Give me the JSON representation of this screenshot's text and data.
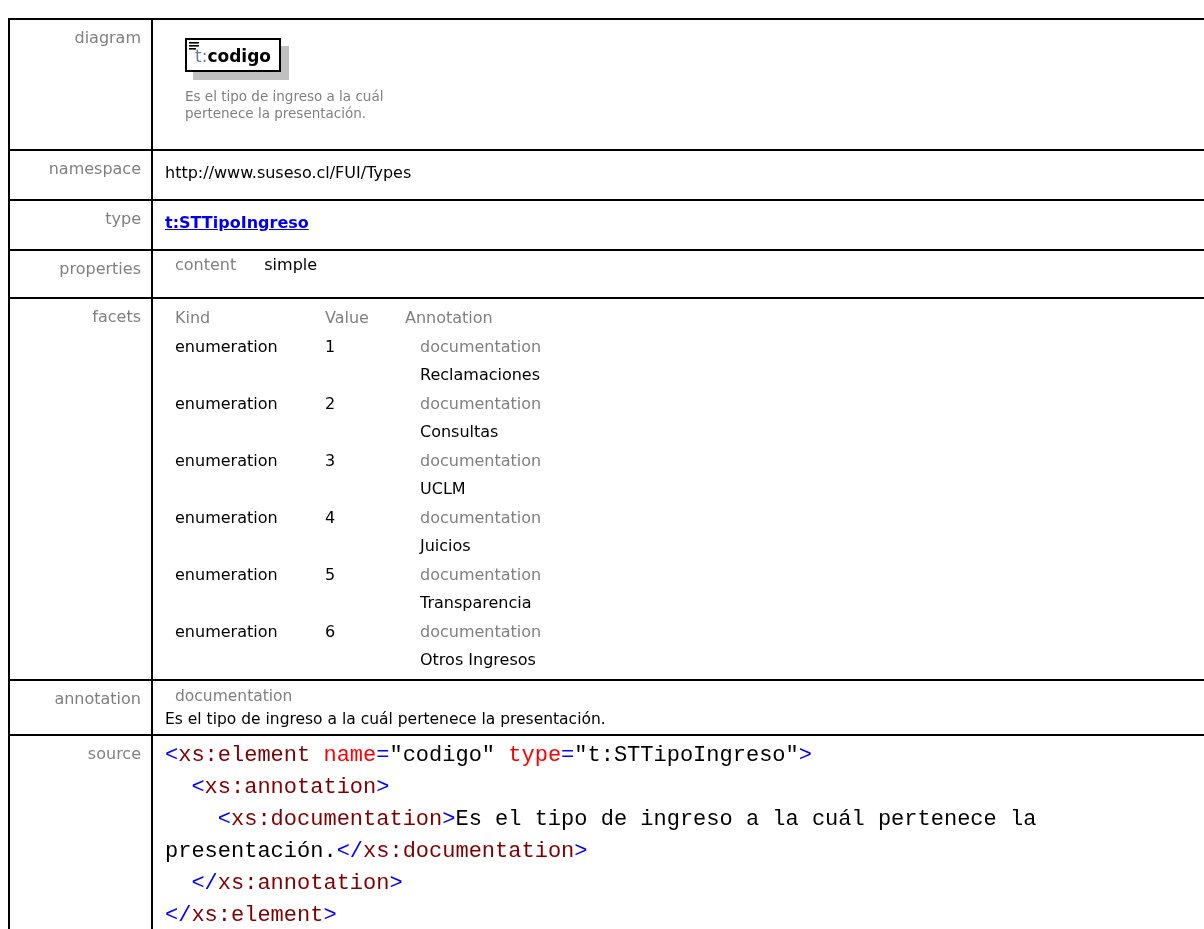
{
  "diagram": {
    "prefix": "t:",
    "name": "codigo",
    "documentation": "Es el tipo de ingreso a la cuál pertenece la presentación."
  },
  "rows": [
    {
      "kind": "diagram",
      "label": "diagram"
    },
    {
      "kind": "text",
      "label": "namespace",
      "value": "http://www.suseso.cl/FUI/Types"
    },
    {
      "kind": "link",
      "label": "type",
      "value": "t:STTipoIngreso"
    },
    {
      "kind": "properties",
      "label": "properties",
      "items": [
        {
          "name": "content",
          "value": "simple"
        }
      ]
    },
    {
      "kind": "facets",
      "label": "facets",
      "columns": [
        "Kind",
        "Value",
        "Annotation"
      ],
      "facets": [
        {
          "kind": "enumeration",
          "value": "1",
          "annotation_label": "documentation",
          "annotation": "Reclamaciones"
        },
        {
          "kind": "enumeration",
          "value": "2",
          "annotation_label": "documentation",
          "annotation": "Consultas"
        },
        {
          "kind": "enumeration",
          "value": "3",
          "annotation_label": "documentation",
          "annotation": "UCLM"
        },
        {
          "kind": "enumeration",
          "value": "4",
          "annotation_label": "documentation",
          "annotation": "Juicios"
        },
        {
          "kind": "enumeration",
          "value": "5",
          "annotation_label": "documentation",
          "annotation": "Transparencia"
        },
        {
          "kind": "enumeration",
          "value": "6",
          "annotation_label": "documentation",
          "annotation": "Otros Ingresos"
        }
      ]
    },
    {
      "kind": "annotation",
      "label": "annotation",
      "annotation_label": "documentation",
      "value": "Es el tipo de ingreso a la cuál pertenece la presentación."
    },
    {
      "kind": "source",
      "label": "source",
      "lines": [
        [
          {
            "kind": "bracket",
            "text": "<"
          },
          {
            "kind": "tag",
            "text": "xs:element"
          },
          {
            "kind": "attr",
            "text": " name"
          },
          {
            "kind": "bracket",
            "text": "="
          },
          {
            "kind": "value",
            "text": "\"codigo\""
          },
          {
            "kind": "attr",
            "text": " type"
          },
          {
            "kind": "bracket",
            "text": "="
          },
          {
            "kind": "value",
            "text": "\"t:STTipoIngreso\""
          },
          {
            "kind": "bracket",
            "text": ">"
          }
        ],
        [
          {
            "kind": "bracket",
            "text": "  <"
          },
          {
            "kind": "tag",
            "text": "xs:annotation"
          },
          {
            "kind": "bracket",
            "text": ">"
          }
        ],
        [
          {
            "kind": "bracket",
            "text": "    <"
          },
          {
            "kind": "tag",
            "text": "xs:documentation"
          },
          {
            "kind": "bracket",
            "text": ">"
          },
          {
            "kind": "text",
            "text": "Es el tipo de ingreso a la cuál pertenece la"
          }
        ],
        [
          {
            "kind": "text",
            "text": "presentación."
          },
          {
            "kind": "bracket",
            "text": "</"
          },
          {
            "kind": "tag",
            "text": "xs:documentation"
          },
          {
            "kind": "bracket",
            "text": ">"
          }
        ],
        [
          {
            "kind": "bracket",
            "text": "  </"
          },
          {
            "kind": "tag",
            "text": "xs:annotation"
          },
          {
            "kind": "bracket",
            "text": ">"
          }
        ],
        [
          {
            "kind": "bracket",
            "text": "</"
          },
          {
            "kind": "tag",
            "text": "xs:element"
          },
          {
            "kind": "bracket",
            "text": ">"
          }
        ]
      ]
    }
  ]
}
